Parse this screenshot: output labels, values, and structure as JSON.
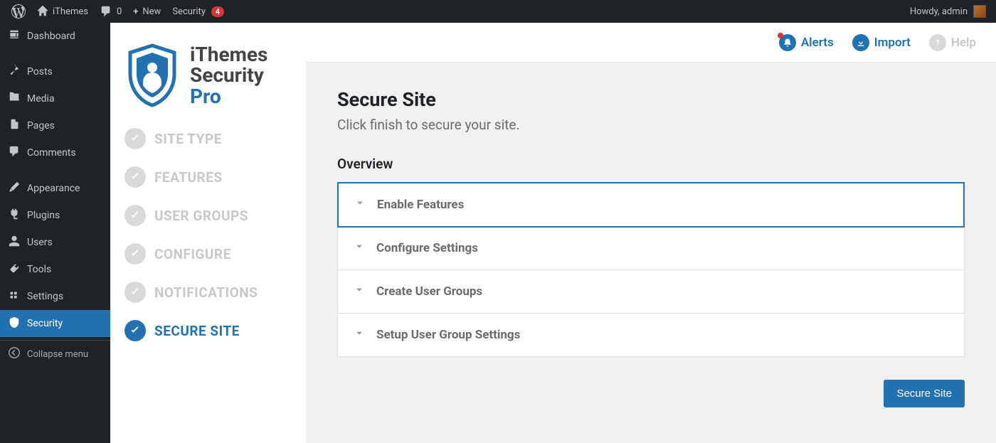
{
  "adminBar": {
    "siteName": "iThemes",
    "commentCount": "0",
    "newLabel": "New",
    "securityLabel": "Security",
    "securityBadge": "4",
    "greeting": "Howdy, admin"
  },
  "wpSidebar": {
    "items": [
      {
        "icon": "dashboard",
        "label": "Dashboard"
      },
      {
        "icon": "pin",
        "label": "Posts"
      },
      {
        "icon": "media",
        "label": "Media"
      },
      {
        "icon": "pages",
        "label": "Pages"
      },
      {
        "icon": "comments",
        "label": "Comments"
      },
      {
        "icon": "appearance",
        "label": "Appearance"
      },
      {
        "icon": "plugins",
        "label": "Plugins"
      },
      {
        "icon": "users",
        "label": "Users"
      },
      {
        "icon": "tools",
        "label": "Tools"
      },
      {
        "icon": "settings",
        "label": "Settings"
      },
      {
        "icon": "security",
        "label": "Security",
        "active": true
      }
    ],
    "collapseLabel": "Collapse menu"
  },
  "pluginLogo": {
    "line1": "iThemes",
    "line2": "Security",
    "line3": "Pro"
  },
  "steps": [
    {
      "label": "SITE TYPE"
    },
    {
      "label": "FEATURES"
    },
    {
      "label": "USER GROUPS"
    },
    {
      "label": "CONFIGURE"
    },
    {
      "label": "NOTIFICATIONS"
    },
    {
      "label": "SECURE SITE",
      "active": true
    }
  ],
  "headerActions": {
    "alerts": "Alerts",
    "import": "Import",
    "help": "Help"
  },
  "content": {
    "title": "Secure Site",
    "subtitle": "Click finish to secure your site.",
    "overviewLabel": "Overview",
    "accordion": [
      {
        "title": "Enable Features",
        "active": true
      },
      {
        "title": "Configure Settings"
      },
      {
        "title": "Create User Groups"
      },
      {
        "title": "Setup User Group Settings"
      }
    ],
    "primaryButton": "Secure Site"
  }
}
